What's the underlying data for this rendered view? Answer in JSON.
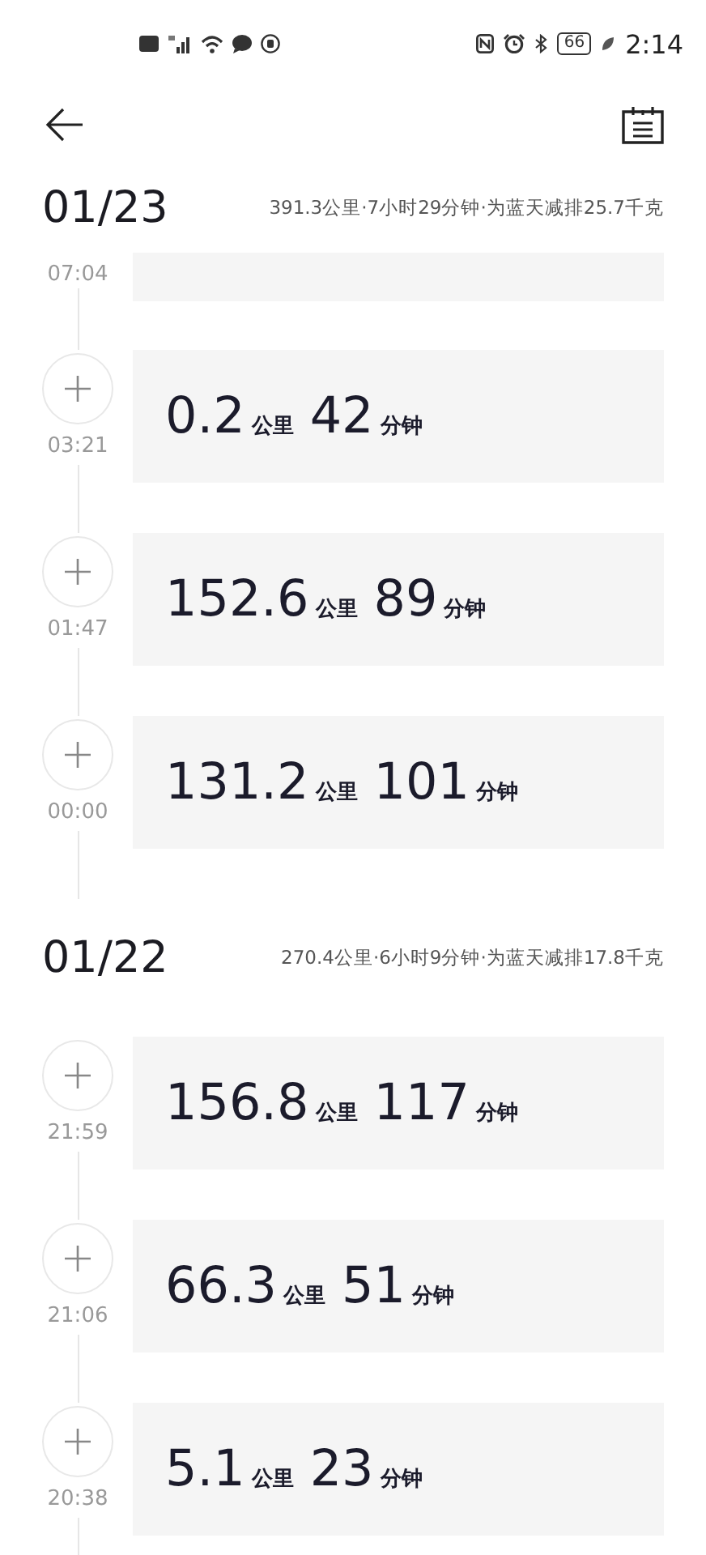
{
  "status_bar": {
    "battery": "66",
    "time": "2:14"
  },
  "sections": [
    {
      "date": "01/23",
      "summary": "391.3公里·7小时29分钟·为蓝天减排25.7千克",
      "cut_trip": {
        "time": "07:04"
      },
      "trips": [
        {
          "time": "03:21",
          "distance": "0.2",
          "distance_unit": "公里",
          "duration": "42",
          "duration_unit": "分钟"
        },
        {
          "time": "01:47",
          "distance": "152.6",
          "distance_unit": "公里",
          "duration": "89",
          "duration_unit": "分钟"
        },
        {
          "time": "00:00",
          "distance": "131.2",
          "distance_unit": "公里",
          "duration": "101",
          "duration_unit": "分钟"
        }
      ]
    },
    {
      "date": "01/22",
      "summary": "270.4公里·6小时9分钟·为蓝天减排17.8千克",
      "trips": [
        {
          "time": "21:59",
          "distance": "156.8",
          "distance_unit": "公里",
          "duration": "117",
          "duration_unit": "分钟"
        },
        {
          "time": "21:06",
          "distance": "66.3",
          "distance_unit": "公里",
          "duration": "51",
          "duration_unit": "分钟"
        },
        {
          "time": "20:38",
          "distance": "5.1",
          "distance_unit": "公里",
          "duration": "23",
          "duration_unit": "分钟"
        }
      ]
    }
  ]
}
